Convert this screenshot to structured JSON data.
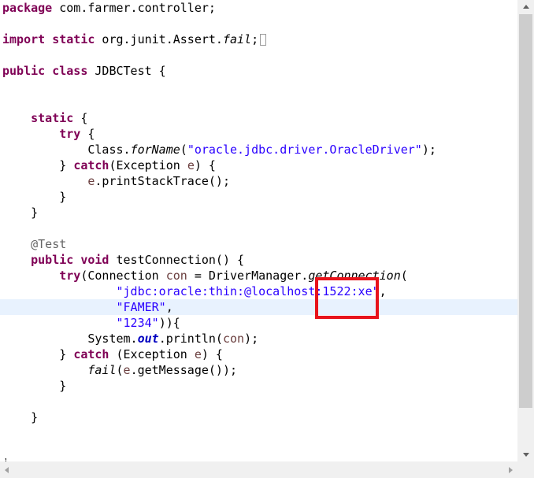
{
  "editor": {
    "lines": [
      {
        "parts": [
          {
            "kw": "package"
          },
          {
            "t": " com.farmer.controller;"
          }
        ]
      },
      {
        "parts": []
      },
      {
        "parts": [
          {
            "kw": "import"
          },
          {
            "t": " "
          },
          {
            "kw": "static"
          },
          {
            "t": " org.junit.Assert."
          },
          {
            "st": "fail"
          },
          {
            "t": ";"
          },
          {
            "fold": true
          }
        ]
      },
      {
        "parts": []
      },
      {
        "parts": [
          {
            "kw": "public"
          },
          {
            "t": " "
          },
          {
            "kw": "class"
          },
          {
            "t": " JDBCTest {"
          }
        ]
      },
      {
        "parts": []
      },
      {
        "parts": []
      },
      {
        "parts": [
          {
            "t": "    "
          },
          {
            "kw": "static"
          },
          {
            "t": " {"
          }
        ]
      },
      {
        "parts": [
          {
            "t": "        "
          },
          {
            "kw": "try"
          },
          {
            "t": " {"
          }
        ]
      },
      {
        "parts": [
          {
            "t": "            Class."
          },
          {
            "st": "forName"
          },
          {
            "t": "("
          },
          {
            "s": "\"oracle.jdbc.driver.OracleDriver\""
          },
          {
            "t": ");"
          }
        ]
      },
      {
        "parts": [
          {
            "t": "        } "
          },
          {
            "kw": "catch"
          },
          {
            "t": "(Exception "
          },
          {
            "v": "e"
          },
          {
            "t": ") {"
          }
        ]
      },
      {
        "parts": [
          {
            "t": "            "
          },
          {
            "v": "e"
          },
          {
            "t": ".printStackTrace();"
          }
        ]
      },
      {
        "parts": [
          {
            "t": "        }"
          }
        ]
      },
      {
        "parts": [
          {
            "t": "    }"
          }
        ]
      },
      {
        "parts": []
      },
      {
        "parts": [
          {
            "t": "    "
          },
          {
            "a": "@Test"
          }
        ]
      },
      {
        "parts": [
          {
            "t": "    "
          },
          {
            "kw": "public"
          },
          {
            "t": " "
          },
          {
            "kw": "void"
          },
          {
            "t": " testConnection() {"
          }
        ]
      },
      {
        "parts": [
          {
            "t": "        "
          },
          {
            "kw": "try"
          },
          {
            "t": "(Connection "
          },
          {
            "v": "con"
          },
          {
            "t": " = DriverManager."
          },
          {
            "st": "getConnection"
          },
          {
            "t": "("
          }
        ]
      },
      {
        "parts": [
          {
            "t": "                "
          },
          {
            "s": "\"jdbc:oracle:thin:@localhost:1522:xe\""
          },
          {
            "t": ","
          }
        ]
      },
      {
        "parts": [
          {
            "t": "                "
          },
          {
            "s": "\"FAMER\""
          },
          {
            "t": ","
          }
        ]
      },
      {
        "parts": [
          {
            "t": "                "
          },
          {
            "s": "\"1234\""
          },
          {
            "t": ")){"
          }
        ]
      },
      {
        "parts": [
          {
            "t": "            System."
          },
          {
            "f": "out"
          },
          {
            "t": ".println("
          },
          {
            "v": "con"
          },
          {
            "t": ");"
          }
        ]
      },
      {
        "parts": [
          {
            "t": "        } "
          },
          {
            "kw": "catch"
          },
          {
            "t": " (Exception "
          },
          {
            "v": "e"
          },
          {
            "t": ") {"
          }
        ]
      },
      {
        "parts": [
          {
            "t": "            "
          },
          {
            "st": "fail"
          },
          {
            "t": "("
          },
          {
            "v": "e"
          },
          {
            "t": ".getMessage());"
          }
        ]
      },
      {
        "parts": [
          {
            "t": "        }"
          }
        ]
      },
      {
        "parts": []
      },
      {
        "parts": [
          {
            "t": "    }"
          }
        ]
      },
      {
        "parts": []
      },
      {
        "parts": []
      }
    ],
    "partial_line": "}"
  },
  "colors": {
    "keyword": "#7f0055",
    "string": "#2a00ff",
    "annotation": "#646464",
    "local_variable": "#6a3e3e",
    "static_field": "#0000c0",
    "current_line_highlight": "#e8f2fe",
    "annotation_box": "#e8131b"
  },
  "icons": {
    "scroll_up": "triangle-up",
    "scroll_down": "triangle-down",
    "scroll_left": "triangle-left",
    "scroll_right": "triangle-right",
    "fold_marker": "collapsed-import-box"
  }
}
